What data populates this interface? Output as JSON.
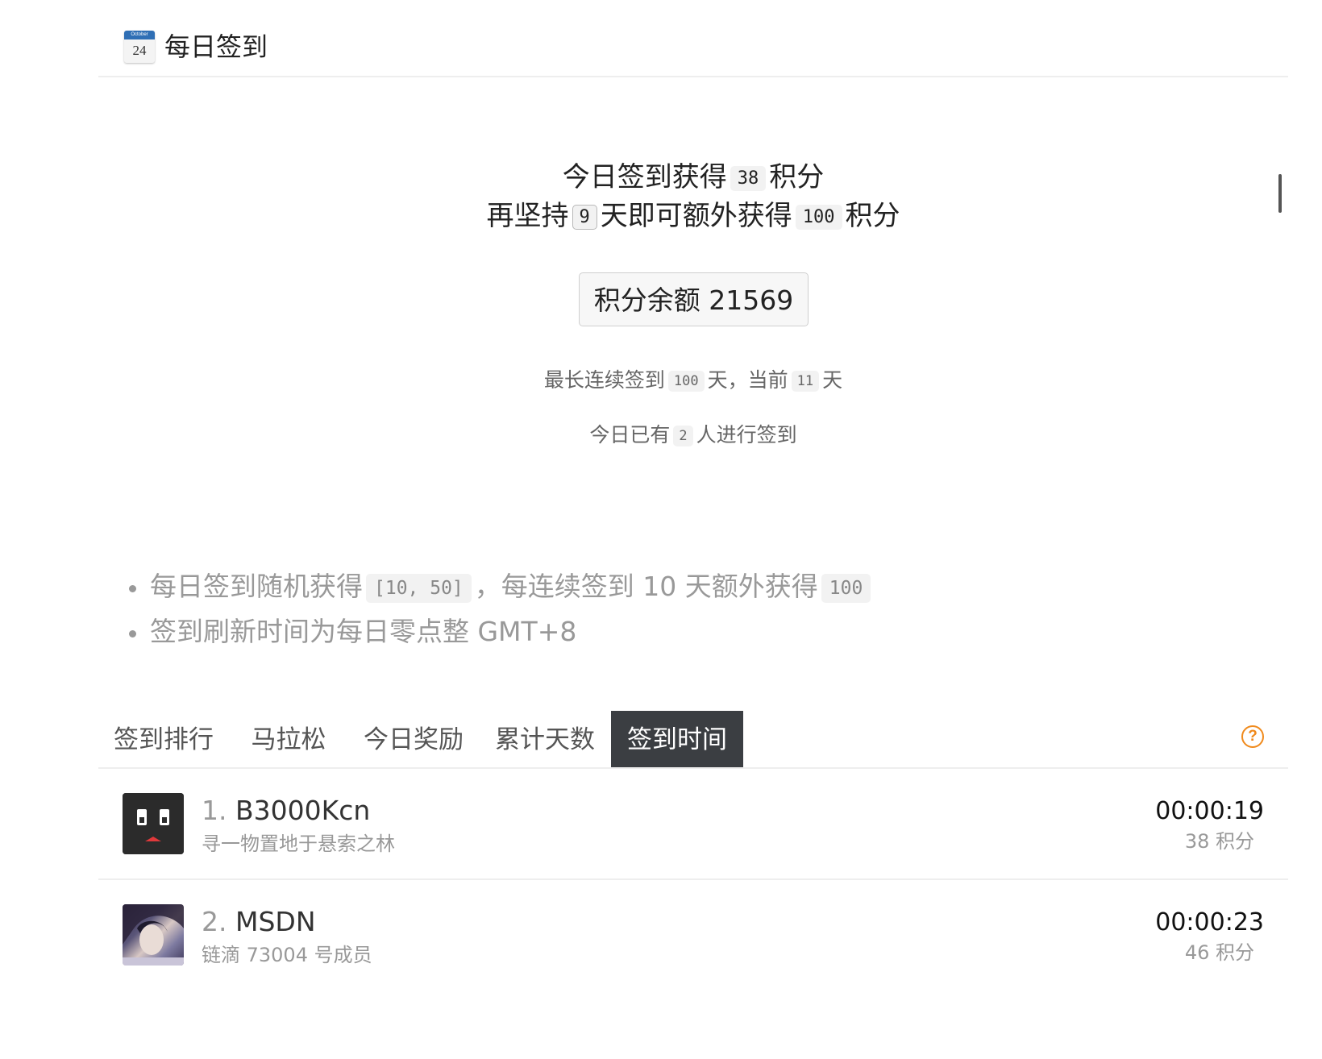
{
  "header": {
    "icon": "calendar-icon",
    "calendar_month": "October",
    "calendar_day": "24",
    "title": "每日签到"
  },
  "summary": {
    "today_prefix": "今日签到获得",
    "today_points": "38",
    "points_unit": "积分",
    "streak_prefix": "再坚持",
    "days_needed": "9",
    "streak_mid": "天即可额外获得",
    "bonus_points": "100",
    "balance_label": "积分余额 21569"
  },
  "stats": {
    "longest_prefix": "最长连续签到",
    "longest_days": "100",
    "longest_mid": "天，当前",
    "current_days": "11",
    "day_unit": "天",
    "today_prefix": "今日已有",
    "today_count": "2",
    "today_suffix": "人进行签到"
  },
  "rules": {
    "rule1_prefix": "每日签到随机获得",
    "rule1_range": "[10, 50]",
    "rule1_mid": "，每连续签到 10 天额外获得",
    "rule1_bonus": "100",
    "rule2": "签到刷新时间为每日零点整 GMT+8"
  },
  "tabs": [
    {
      "label": "签到排行",
      "active": false
    },
    {
      "label": "马拉松",
      "active": false
    },
    {
      "label": "今日奖励",
      "active": false
    },
    {
      "label": "累计天数",
      "active": false
    },
    {
      "label": "签到时间",
      "active": true
    }
  ],
  "ranking": [
    {
      "rank": "1.",
      "name": "B3000Kcn",
      "subtitle": "寻一物置地于悬索之林",
      "time": "00:00:19",
      "points": "38 积分"
    },
    {
      "rank": "2.",
      "name": "MSDN",
      "subtitle": "链滴 73004 号成员",
      "time": "00:00:23",
      "points": "46 积分"
    }
  ],
  "colors": {
    "active_tab_bg": "#3b3e42",
    "help_icon": "#f08a1c",
    "muted_text": "#999999"
  }
}
